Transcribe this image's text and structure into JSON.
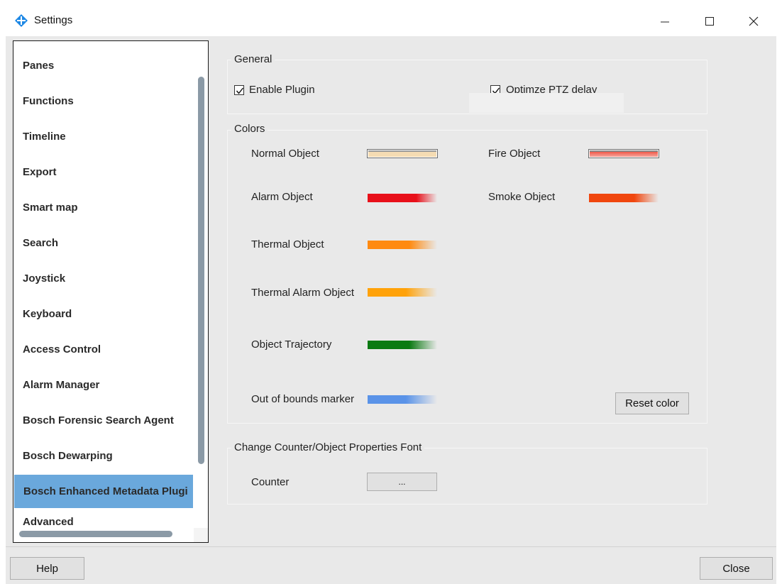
{
  "window": {
    "title": "Settings",
    "icons": {
      "app": "app-diamond-icon",
      "minimize": "minimize-icon",
      "maximize": "maximize-icon",
      "close": "close-icon"
    },
    "colors": {
      "accent": "#6aa8dc",
      "background": "#e9e9e9"
    }
  },
  "sidebar": {
    "items": [
      {
        "label": "Panes"
      },
      {
        "label": "Functions"
      },
      {
        "label": "Timeline"
      },
      {
        "label": "Export"
      },
      {
        "label": "Smart map"
      },
      {
        "label": "Search"
      },
      {
        "label": "Joystick"
      },
      {
        "label": "Keyboard"
      },
      {
        "label": "Access Control"
      },
      {
        "label": "Alarm Manager"
      },
      {
        "label": "Bosch Forensic Search Agent"
      },
      {
        "label": "Bosch Dewarping"
      },
      {
        "label": "Bosch Enhanced Metadata Plugi",
        "selected": true
      },
      {
        "label": "Advanced"
      }
    ]
  },
  "general": {
    "title": "General",
    "enable_plugin": {
      "label": "Enable Plugin",
      "checked": true
    },
    "optimize_ptz": {
      "label": "Optimze PTZ delay",
      "checked": true
    }
  },
  "colors": {
    "title": "Colors",
    "normal_object": {
      "label": "Normal Object",
      "color": "#f5dcb3"
    },
    "alarm_object": {
      "label": "Alarm Object",
      "color": "#e8101a"
    },
    "thermal_object": {
      "label": "Thermal Object",
      "color": "#ff8a10"
    },
    "thermal_alarm_object": {
      "label": "Thermal Alarm Object",
      "color": "#ffa20a"
    },
    "object_trajectory": {
      "label": "Object Trajectory",
      "color": "#0b7a12"
    },
    "out_of_bounds_marker": {
      "label": "Out of bounds marker",
      "color": "#5a93e8"
    },
    "fire_object": {
      "label": "Fire Object",
      "color": "#f05a4a"
    },
    "smoke_object": {
      "label": "Smoke Object",
      "color": "#f0460e"
    },
    "reset_label": "Reset color"
  },
  "font": {
    "title": "Change Counter/Object Properties Font",
    "counter_label": "Counter",
    "counter_button": "..."
  },
  "footer": {
    "help_label": "Help",
    "close_label": "Close"
  }
}
